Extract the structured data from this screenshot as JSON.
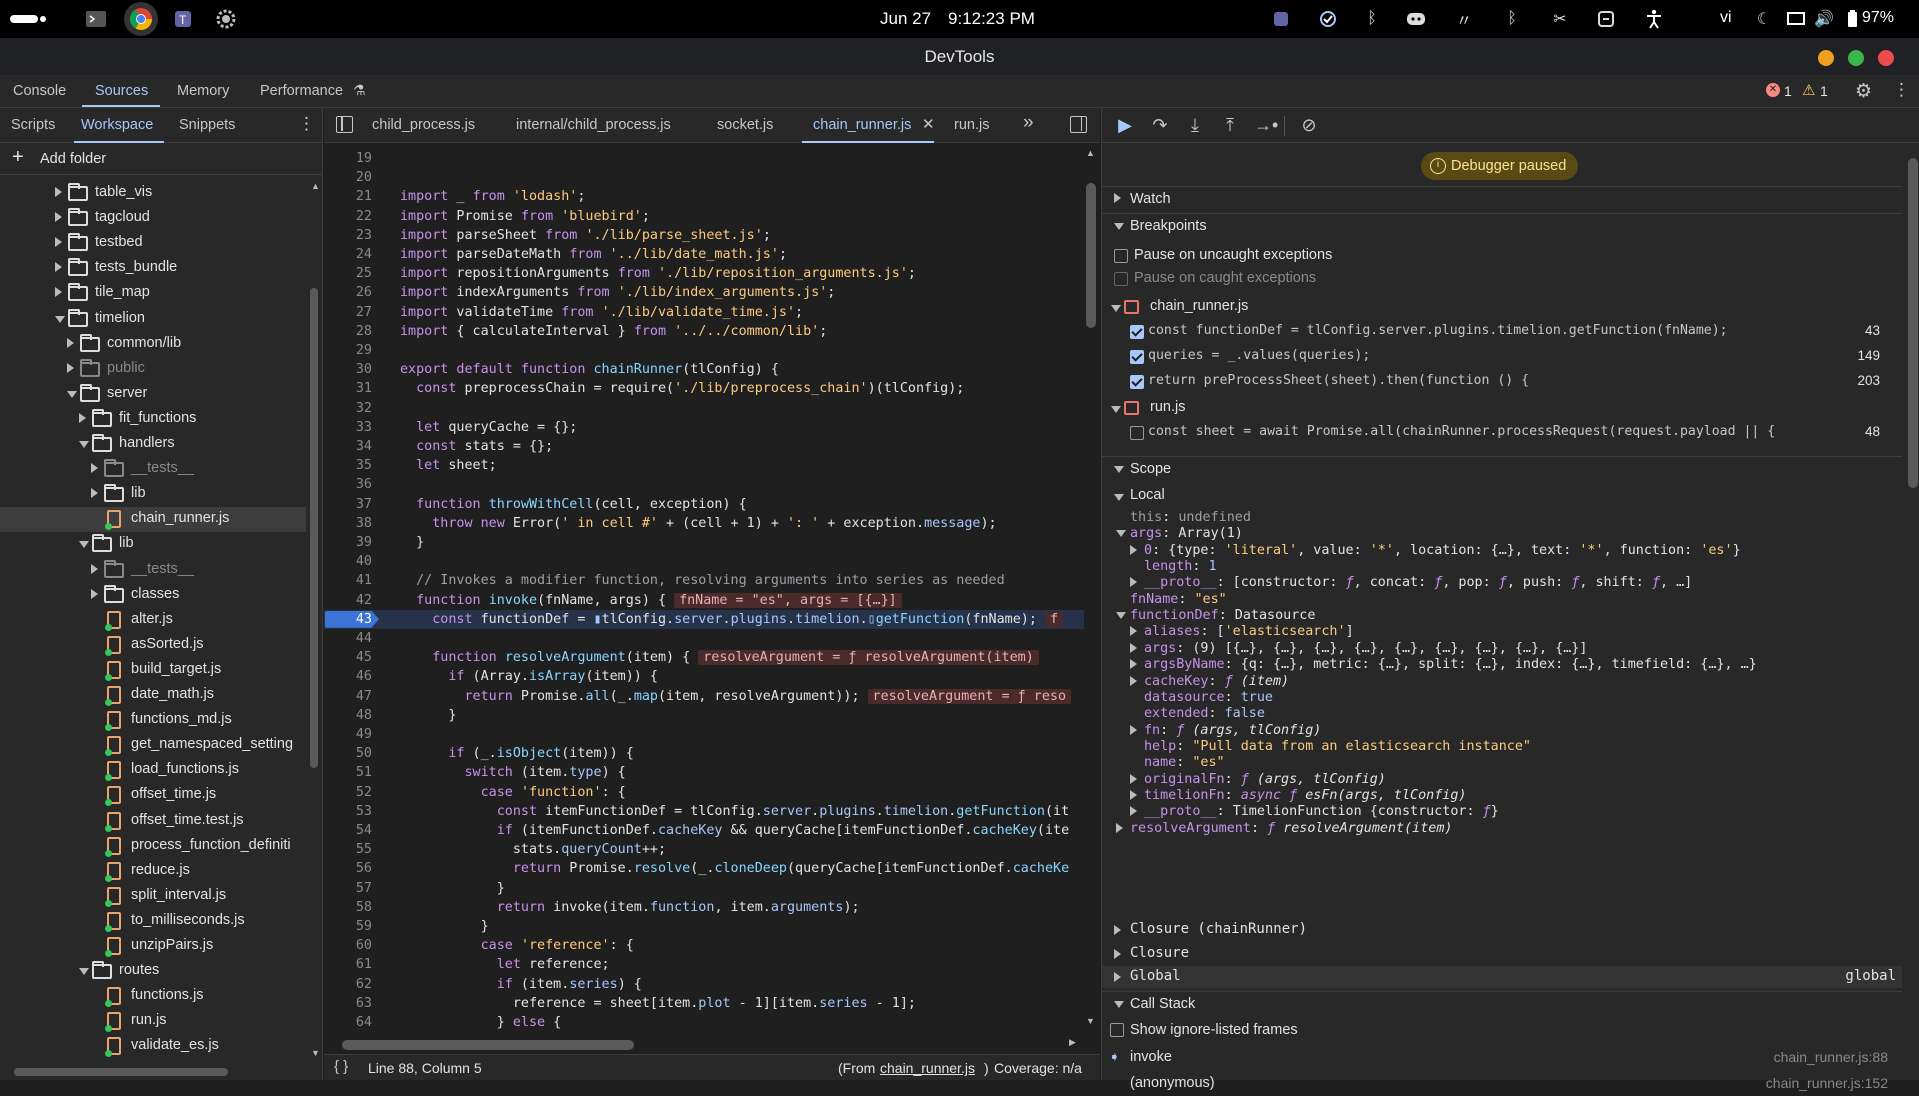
{
  "os": {
    "date": "Jun 27",
    "time": "9:12:23 PM",
    "lang": "vi",
    "battery": "97%"
  },
  "window": {
    "title": "DevTools"
  },
  "main_tabs": [
    "Console",
    "Sources",
    "Memory",
    "Performance"
  ],
  "issues": {
    "errors": "1",
    "warnings": "1"
  },
  "navigator": {
    "tabs": [
      "Scripts",
      "Workspace",
      "Snippets"
    ],
    "add_folder": "Add folder",
    "tree": [
      {
        "label": "table_vis",
        "type": "folder",
        "depth": 0,
        "open": false
      },
      {
        "label": "tagcloud",
        "type": "folder",
        "depth": 0,
        "open": false
      },
      {
        "label": "testbed",
        "type": "folder",
        "depth": 0,
        "open": false
      },
      {
        "label": "tests_bundle",
        "type": "folder",
        "depth": 0,
        "open": false
      },
      {
        "label": "tile_map",
        "type": "folder",
        "depth": 0,
        "open": false
      },
      {
        "label": "timelion",
        "type": "folder",
        "depth": 0,
        "open": true
      },
      {
        "label": "common/lib",
        "type": "folder",
        "depth": 1,
        "open": false
      },
      {
        "label": "public",
        "type": "folder",
        "depth": 1,
        "open": false,
        "dim": true
      },
      {
        "label": "server",
        "type": "folder",
        "depth": 1,
        "open": true
      },
      {
        "label": "fit_functions",
        "type": "folder",
        "depth": 2,
        "open": false
      },
      {
        "label": "handlers",
        "type": "folder",
        "depth": 2,
        "open": true
      },
      {
        "label": "__tests__",
        "type": "folder",
        "depth": 3,
        "open": false,
        "dim": true
      },
      {
        "label": "lib",
        "type": "folder",
        "depth": 3,
        "open": false
      },
      {
        "label": "chain_runner.js",
        "type": "file",
        "depth": 3,
        "selected": true
      },
      {
        "label": "lib",
        "type": "folder",
        "depth": 2,
        "open": true
      },
      {
        "label": "__tests__",
        "type": "folder",
        "depth": 3,
        "open": false,
        "dim": true
      },
      {
        "label": "classes",
        "type": "folder",
        "depth": 3,
        "open": false
      },
      {
        "label": "alter.js",
        "type": "file",
        "depth": 3
      },
      {
        "label": "asSorted.js",
        "type": "file",
        "depth": 3
      },
      {
        "label": "build_target.js",
        "type": "file",
        "depth": 3
      },
      {
        "label": "date_math.js",
        "type": "file",
        "depth": 3
      },
      {
        "label": "functions_md.js",
        "type": "file",
        "depth": 3
      },
      {
        "label": "get_namespaced_setting",
        "type": "file",
        "depth": 3
      },
      {
        "label": "load_functions.js",
        "type": "file",
        "depth": 3
      },
      {
        "label": "offset_time.js",
        "type": "file",
        "depth": 3
      },
      {
        "label": "offset_time.test.js",
        "type": "file",
        "depth": 3
      },
      {
        "label": "process_function_definiti",
        "type": "file",
        "depth": 3
      },
      {
        "label": "reduce.js",
        "type": "file",
        "depth": 3
      },
      {
        "label": "split_interval.js",
        "type": "file",
        "depth": 3
      },
      {
        "label": "to_milliseconds.js",
        "type": "file",
        "depth": 3
      },
      {
        "label": "unzipPairs.js",
        "type": "file",
        "depth": 3
      },
      {
        "label": "routes",
        "type": "folder",
        "depth": 2,
        "open": true
      },
      {
        "label": "functions.js",
        "type": "file",
        "depth": 3
      },
      {
        "label": "run.js",
        "type": "file",
        "depth": 3
      },
      {
        "label": "validate_es.js",
        "type": "file",
        "depth": 3
      }
    ]
  },
  "editor": {
    "tabs": [
      "child_process.js",
      "internal/child_process.js",
      "socket.js",
      "chain_runner.js",
      "run.js"
    ],
    "active_tab": "chain_runner.js",
    "paused_line": 43,
    "lines": [
      {
        "n": 19,
        "html": ""
      },
      {
        "n": 20,
        "html": ""
      },
      {
        "n": 21,
        "html": "<span class='k'>import</span> _ <span class='k'>from</span> <span class='s'>'lodash'</span>;"
      },
      {
        "n": 22,
        "html": "<span class='k'>import</span> Promise <span class='k'>from</span> <span class='s'>'bluebird'</span>;"
      },
      {
        "n": 23,
        "html": "<span class='k'>import</span> parseSheet <span class='k'>from</span> <span class='s'>'./lib/parse_sheet.js'</span>;"
      },
      {
        "n": 24,
        "html": "<span class='k'>import</span> parseDateMath <span class='k'>from</span> <span class='s'>'../lib/date_math.js'</span>;"
      },
      {
        "n": 25,
        "html": "<span class='k'>import</span> repositionArguments <span class='k'>from</span> <span class='s'>'./lib/reposition_arguments.js'</span>;"
      },
      {
        "n": 26,
        "html": "<span class='k'>import</span> indexArguments <span class='k'>from</span> <span class='s'>'./lib/index_arguments.js'</span>;"
      },
      {
        "n": 27,
        "html": "<span class='k'>import</span> validateTime <span class='k'>from</span> <span class='s'>'./lib/validate_time.js'</span>;"
      },
      {
        "n": 28,
        "html": "<span class='k'>import</span> { calculateInterval } <span class='k'>from</span> <span class='s'>'../../common/lib'</span>;"
      },
      {
        "n": 29,
        "html": ""
      },
      {
        "n": 30,
        "html": "<span class='k'>export default function</span> <span class='fn'>chainRunner</span>(tlConfig) {"
      },
      {
        "n": 31,
        "html": "  <span class='k'>const</span> preprocessChain = require(<span class='s'>'./lib/preprocess_chain'</span>)(tlConfig);"
      },
      {
        "n": 32,
        "html": ""
      },
      {
        "n": 33,
        "html": "  <span class='k'>let</span> queryCache = {};"
      },
      {
        "n": 34,
        "html": "  <span class='k'>const</span> stats = {};"
      },
      {
        "n": 35,
        "html": "  <span class='k'>let</span> sheet;"
      },
      {
        "n": 36,
        "html": ""
      },
      {
        "n": 37,
        "html": "  <span class='k'>function</span> <span class='fn'>throwWithCell</span>(cell, exception) {"
      },
      {
        "n": 38,
        "html": "    <span class='k'>throw new</span> Error(<span class='s'>' in cell #'</span> + (cell + 1) + <span class='s'>': '</span> + exception.<span class='prop'>message</span>);"
      },
      {
        "n": 39,
        "html": "  }"
      },
      {
        "n": 40,
        "html": ""
      },
      {
        "n": 41,
        "html": "  <span class='c'>// Invokes a modifier function, resolving arguments into series as needed</span>"
      },
      {
        "n": 42,
        "html": "  <span class='k'>function</span> <span class='fn'>invoke</span>(fnName, args) {<span class='inline-val'>fnName = \"es\", args = [{…}]</span>"
      },
      {
        "n": 43,
        "html": "    <span class='k'>const</span> functionDef = <span style='color:#a8c7fa'>▮</span>tlConfig.<span class='prop'>server</span>.<span class='prop'>plugins</span>.<span class='prop'>timelion</span>.<span style='color:#a8c7fa'>▯</span><span class='fn'>getFunction</span>(fnName);<span class='inline-val'>f</span>"
      },
      {
        "n": 44,
        "html": ""
      },
      {
        "n": 45,
        "html": "    <span class='k'>function</span> <span class='fn'>resolveArgument</span>(item) {<span class='inline-val'>resolveArgument = ƒ resolveArgument(item)</span>"
      },
      {
        "n": 46,
        "html": "      <span class='k'>if</span> (Array.<span class='fn'>isArray</span>(item)) {"
      },
      {
        "n": 47,
        "html": "        <span class='k'>return</span> Promise.<span class='fn'>all</span>(_.<span class='fn'>map</span>(item, resolveArgument));<span class='inline-val'>resolveArgument = ƒ reso</span>"
      },
      {
        "n": 48,
        "html": "      }"
      },
      {
        "n": 49,
        "html": ""
      },
      {
        "n": 50,
        "html": "      <span class='k'>if</span> (_.<span class='fn'>isObject</span>(item)) {"
      },
      {
        "n": 51,
        "html": "        <span class='k'>switch</span> (item.<span class='prop'>type</span>) {"
      },
      {
        "n": 52,
        "html": "          <span class='k'>case</span> <span class='s'>'function'</span>: {"
      },
      {
        "n": 53,
        "html": "            <span class='k'>const</span> itemFunctionDef = tlConfig.<span class='prop'>server</span>.<span class='prop'>plugins</span>.<span class='prop'>timelion</span>.<span class='fn'>getFunction</span>(it"
      },
      {
        "n": 54,
        "html": "            <span class='k'>if</span> (itemFunctionDef.<span class='prop'>cacheKey</span> &amp;&amp; queryCache[itemFunctionDef.<span class='fn'>cacheKey</span>(ite"
      },
      {
        "n": 55,
        "html": "              stats.<span class='prop'>queryCount</span>++;"
      },
      {
        "n": 56,
        "html": "              <span class='k'>return</span> Promise.<span class='fn'>resolve</span>(_.<span class='fn'>cloneDeep</span>(queryCache[itemFunctionDef.<span class='fn'>cacheKe</span>"
      },
      {
        "n": 57,
        "html": "            }"
      },
      {
        "n": 58,
        "html": "            <span class='k'>return</span> invoke(item.<span class='prop'>function</span>, item.<span class='prop'>arguments</span>);"
      },
      {
        "n": 59,
        "html": "          }"
      },
      {
        "n": 60,
        "html": "          <span class='k'>case</span> <span class='s'>'reference'</span>: {"
      },
      {
        "n": 61,
        "html": "            <span class='k'>let</span> reference;"
      },
      {
        "n": 62,
        "html": "            <span class='k'>if</span> (item.<span class='prop'>series</span>) {"
      },
      {
        "n": 63,
        "html": "              reference = sheet[item.<span class='prop'>plot</span> - 1][item.<span class='prop'>series</span> - 1];"
      },
      {
        "n": 64,
        "html": "            } <span class='k'>else</span> {"
      }
    ],
    "status": {
      "position": "Line 88, Column 5",
      "from_prefix": "(From",
      "from_file": "chain_runner.js",
      "from_suffix": ")",
      "coverage": "Coverage: n/a"
    }
  },
  "debugger": {
    "banner": "Debugger paused",
    "watch": "Watch",
    "breakpoints_title": "Breakpoints",
    "pause_uncaught": "Pause on uncaught exceptions",
    "pause_caught": "Pause on caught exceptions",
    "bp_files": [
      {
        "file": "chain_runner.js",
        "items": [
          {
            "code": "const functionDef = tlConfig.server.plugins.timelion.getFunction(fnName);",
            "line": "43",
            "checked": true
          },
          {
            "code": "queries = _.values(queries);",
            "line": "149",
            "checked": true
          },
          {
            "code": "return preProcessSheet(sheet).then(function () {",
            "line": "203",
            "checked": true
          }
        ]
      },
      {
        "file": "run.js",
        "items": [
          {
            "code": "const sheet = await Promise.all(chainRunner.processRequest(request.payload || {",
            "line": "48",
            "checked": false
          }
        ]
      }
    ],
    "scope_title": "Scope",
    "local_title": "Local",
    "scope_rows": [
      {
        "indent": 0,
        "arrow": "",
        "html": "<span class='pv-g'>this</span>: <span class='pv-g'>undefined</span>"
      },
      {
        "indent": 0,
        "arrow": "d",
        "html": "<span class='pk'>args</span>: Array(1)"
      },
      {
        "indent": 1,
        "arrow": "r",
        "html": "<span class='pk'>0</span>: {type: <span class='pv-s'>'literal'</span>, value: <span class='pv-s'>'*'</span>, location: {…}, text: <span class='pv-s'>'*'</span>, function: <span class='pv-s'>'es'</span>}"
      },
      {
        "indent": 1,
        "arrow": "",
        "html": "<span class='pk'>length</span>: <span class='pv-n'>1</span>"
      },
      {
        "indent": 1,
        "arrow": "r",
        "html": "<span class='pk'>__proto__</span>: [constructor: <span class='fsym'>ƒ</span>, concat: <span class='fsym'>ƒ</span>, pop: <span class='fsym'>ƒ</span>, push: <span class='fsym'>ƒ</span>, shift: <span class='fsym'>ƒ</span>, …]"
      },
      {
        "indent": 0,
        "arrow": "",
        "html": "<span class='pk'>fnName</span>: <span class='pv-s'>\"es\"</span>"
      },
      {
        "indent": 0,
        "arrow": "d",
        "html": "<span class='pk'>functionDef</span>: Datasource"
      },
      {
        "indent": 1,
        "arrow": "r",
        "html": "<span class='pk'>aliases</span>: [<span class='pv-s'>'elasticsearch'</span>]"
      },
      {
        "indent": 1,
        "arrow": "r",
        "html": "<span class='pk'>args</span>: (9) [{…}, {…}, {…}, {…}, {…}, {…}, {…}, {…}, {…}]"
      },
      {
        "indent": 1,
        "arrow": "r",
        "html": "<span class='pk'>argsByName</span>: {q: {…}, metric: {…}, split: {…}, index: {…}, timefield: {…}, …}"
      },
      {
        "indent": 1,
        "arrow": "r",
        "html": "<span class='pk'>cacheKey</span>: <span class='fsym'>ƒ</span> <span class='pv-f'>(item)</span>"
      },
      {
        "indent": 1,
        "arrow": "",
        "html": "<span class='pk'>datasource</span>: <span class='pv-n'>true</span>"
      },
      {
        "indent": 1,
        "arrow": "",
        "html": "<span class='pk'>extended</span>: <span class='pv-n'>false</span>"
      },
      {
        "indent": 1,
        "arrow": "r",
        "html": "<span class='pk'>fn</span>: <span class='fsym'>ƒ</span> <span class='pv-f'>(args, tlConfig)</span>"
      },
      {
        "indent": 1,
        "arrow": "",
        "html": "<span class='pk'>help</span>: <span class='pv-s'>\"Pull data from an elasticsearch instance\"</span>"
      },
      {
        "indent": 1,
        "arrow": "",
        "html": "<span class='pk'>name</span>: <span class='pv-s'>\"es\"</span>"
      },
      {
        "indent": 1,
        "arrow": "r",
        "html": "<span class='pk'>originalFn</span>: <span class='fsym'>ƒ</span> <span class='pv-f'>(args, tlConfig)</span>"
      },
      {
        "indent": 1,
        "arrow": "r",
        "html": "<span class='pk'>timelionFn</span>: <span class='fsym'>async ƒ</span> <span class='pv-f'>esFn(args, tlConfig)</span>"
      },
      {
        "indent": 1,
        "arrow": "r",
        "html": "<span class='pk'>__proto__</span>: TimelionFunction {constructor: <span class='fsym'>ƒ</span>}"
      },
      {
        "indent": 0,
        "arrow": "r",
        "html": "<span class='pk'>resolveArgument</span>: <span class='fsym'>ƒ</span> <span class='pv-f'>resolveArgument(item)</span>"
      }
    ],
    "closure_runner": "Closure (chainRunner)",
    "closure": "Closure",
    "global": "Global",
    "global_value": "global",
    "callstack_title": "Call Stack",
    "show_ignore": "Show ignore-listed frames",
    "frames": [
      {
        "name": "invoke",
        "loc": "chain_runner.js:88",
        "current": true
      },
      {
        "name": "(anonymous)",
        "loc": "chain_runner.js:152",
        "current": false
      }
    ]
  }
}
